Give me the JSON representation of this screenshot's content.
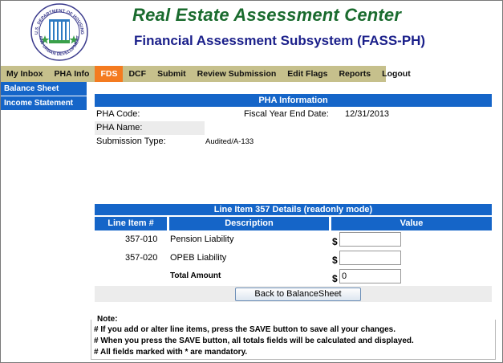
{
  "header": {
    "title": "Real Estate Assessment Center",
    "subtitle": "Financial Assessment Subsystem (FASS-PH)",
    "logo_text": "U.S. DEPARTMENT OF HOUSING AND URBAN DEVELOPMENT"
  },
  "nav": {
    "items": [
      "My Inbox",
      "PHA Info",
      "FDS",
      "DCF",
      "Submit",
      "Review Submission",
      "Edit Flags",
      "Reports",
      "Logout"
    ],
    "active": "FDS"
  },
  "sidebar": {
    "items": [
      "Balance Sheet",
      "Income Statement"
    ]
  },
  "pha_info": {
    "heading": "PHA Information",
    "code_label": "PHA Code:",
    "fye_label": "Fiscal Year End Date:",
    "fye_value": "12/31/2013",
    "name_label": "PHA Name:",
    "submission_type_label": "Submission Type:",
    "submission_type_value": "Audited/A-133"
  },
  "line_item": {
    "heading": "Line Item 357 Details (readonly mode)",
    "columns": [
      "Line Item #",
      "Description",
      "Value"
    ],
    "rows": [
      {
        "code": "357-010",
        "description": "Pension Liability",
        "currency": "$",
        "value": ""
      },
      {
        "code": "357-020",
        "description": "OPEB Liability",
        "currency": "$",
        "value": ""
      }
    ],
    "total_label": "Total Amount",
    "total_currency": "$",
    "total_value": "0",
    "back_button": "Back to BalanceSheet"
  },
  "note": {
    "legend": "Note:",
    "lines": [
      "# If you add or alter line items, press the SAVE button to save all your changes.",
      "# When you press the SAVE button, all totals fields will be calculated and displayed.",
      "# All fields marked with * are mandatory."
    ]
  },
  "colors": {
    "title_green": "#1a6b2e",
    "subtitle_blue": "#1a1f8a",
    "nav_bg": "#c6c08c",
    "nav_active": "#f47b20",
    "bar_blue": "#1565c8"
  }
}
